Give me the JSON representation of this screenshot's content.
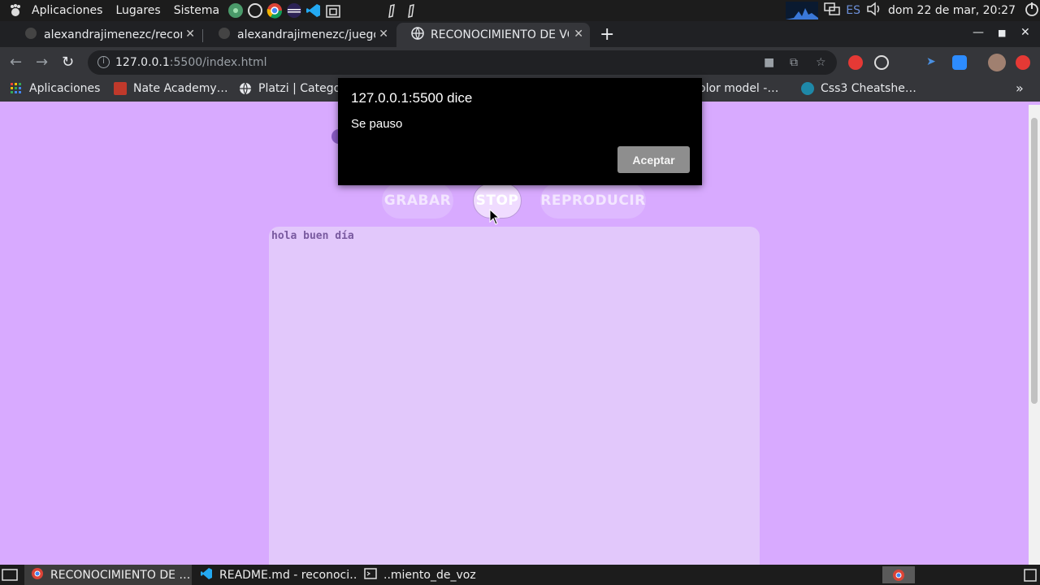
{
  "top_panel": {
    "menus": [
      "Aplicaciones",
      "Lugares",
      "Sistema"
    ],
    "language": "ES",
    "clock": "dom 22 de mar, 20:27"
  },
  "tabs": [
    {
      "title": "alexandrajimenezc/recon"
    },
    {
      "title": "alexandrajimenezc/juego"
    },
    {
      "title": "RECONOCIMIENTO DE VO"
    }
  ],
  "omnibox": {
    "host": "127.0.0.1",
    "path": ":5500/index.html"
  },
  "bookmarks": [
    {
      "label": "Aplicaciones"
    },
    {
      "label": "Nate Academy…"
    },
    {
      "label": "Platzi | Catego"
    },
    {
      "label": "olor model -…"
    },
    {
      "label": "Css3 Cheatshe…"
    }
  ],
  "bookmarks_more": "»",
  "page": {
    "buttons": {
      "record": "GRABAR",
      "stop": "STOP",
      "play": "REPRODUCIR"
    },
    "transcript": "hola buen día"
  },
  "dialog": {
    "title": "127.0.0.1:5500 dice",
    "message": "Se pauso",
    "ok": "Aceptar"
  },
  "taskbar": [
    {
      "label": "RECONOCIMIENTO DE …"
    },
    {
      "label": "README.md - reconoci…"
    },
    {
      "label": "..miento_de_voz"
    }
  ],
  "colors": {
    "page_bg": "#d8aaff",
    "textarea_bg": "#e2c8fb",
    "dialog_bg": "#000000"
  }
}
